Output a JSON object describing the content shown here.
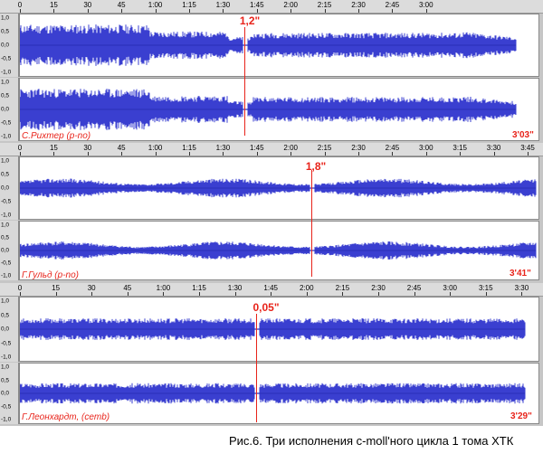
{
  "panels": [
    {
      "ticks": [
        "0",
        "15",
        "30",
        "45",
        "1:00",
        "1:15",
        "1:30",
        "1:45",
        "2:00",
        "2:15",
        "2:30",
        "2:45",
        "3:00"
      ],
      "performer": "С.Рихтер (p-no)",
      "duration": "3'03\"",
      "gap_label": "1,2\"",
      "y_labels": [
        "1,0",
        "0,5",
        "0,0",
        "-0,5",
        "-1,0"
      ]
    },
    {
      "ticks": [
        "0",
        "15",
        "30",
        "45",
        "1:00",
        "1:15",
        "1:30",
        "1:45",
        "2:00",
        "2:15",
        "2:30",
        "2:45",
        "3:00",
        "3:15",
        "3:30",
        "3:45"
      ],
      "performer": "Г.Гульд (p-no)",
      "duration": "3'41\"",
      "gap_label": "1,8\"",
      "y_labels": [
        "1,0",
        "0,5",
        "0,0",
        "-0,5",
        "-1,0"
      ]
    },
    {
      "ticks": [
        "0",
        "15",
        "30",
        "45",
        "1:00",
        "1:15",
        "1:30",
        "1:45",
        "2:00",
        "2:15",
        "2:30",
        "2:45",
        "3:00",
        "3:15",
        "3:30"
      ],
      "performer": "Г.Леонхардт, (cemb)",
      "duration": "3'29\"",
      "gap_label": "0,05\"",
      "y_labels": [
        "1,0",
        "0,5",
        "0,0",
        "-0,5",
        "-1,0"
      ]
    }
  ],
  "caption": "Рис.6. Три исполнения c-moll'ного цикла 1 тома ХТК",
  "colors": {
    "wave": "#3a3fd0",
    "wave_core": "#2a2fb8",
    "marker": "#e8231a"
  }
}
